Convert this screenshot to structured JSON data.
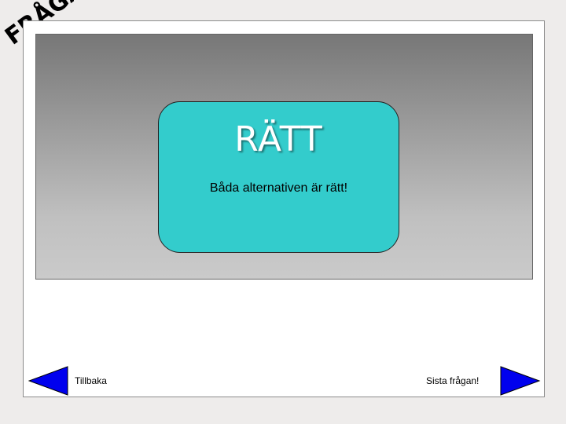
{
  "logo": {
    "text": "FRÅGA",
    "color": "#000000"
  },
  "answer": {
    "title": "RÄTT",
    "message": "Båda alternativen är rätt!",
    "box_color": "#33cccc"
  },
  "navigation": {
    "back_label": "Tillbaka",
    "next_label": "Sista frågan!",
    "arrow_color": "#0000ee"
  }
}
